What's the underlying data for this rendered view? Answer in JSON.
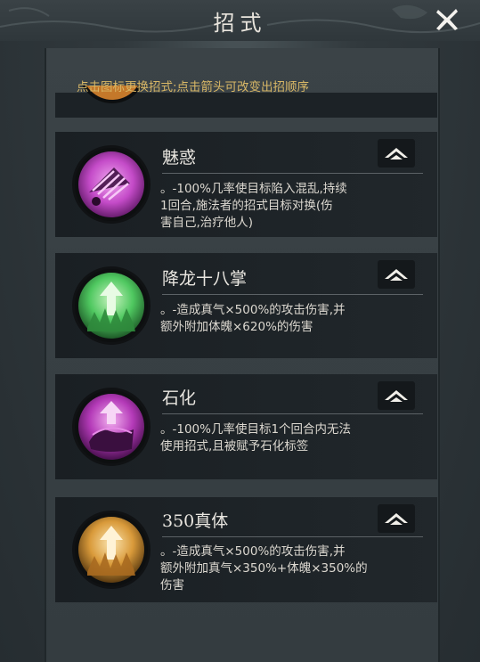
{
  "header": {
    "title": "招式"
  },
  "hint": "点击图标更换招式;点击箭头可改变出招顺序",
  "skills": [
    {
      "name": "魅惑",
      "desc_lines": [
        "。-100%几率使目标陷入混乱,持续",
        "1回合,施法者的招式目标对换(伤",
        "害自己,治疗他人)"
      ],
      "icon": "fan-icon",
      "color": "#c44bc8"
    },
    {
      "name": "降龙十八掌",
      "desc_lines": [
        "。-造成真气×500%的攻击伤害,并",
        "额外附加体魄×620%的伤害"
      ],
      "icon": "green-crystal-arrow-icon",
      "color": "#4fc860"
    },
    {
      "name": "石化",
      "desc_lines": [
        "。-100%几率使目标1个回合内无法",
        "使用招式,且被赋予石化标签"
      ],
      "icon": "petrify-hand-icon",
      "color": "#c44bc8"
    },
    {
      "name": "350真体",
      "desc_lines": [
        "。-造成真气×500%的攻击伤害,并",
        "额外附加真气×350%+体魄×350%的",
        "伤害"
      ],
      "icon": "gold-crystal-arrow-icon",
      "color": "#e0a640"
    }
  ]
}
